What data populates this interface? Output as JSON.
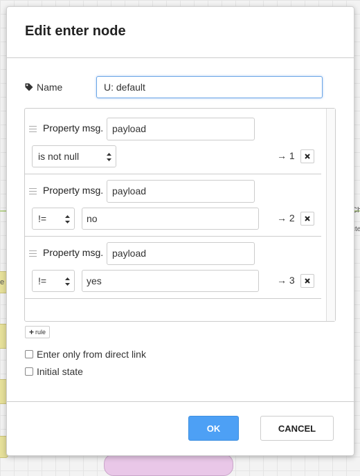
{
  "workspace": {
    "left_node_text": "te",
    "bottom_left_node_text": "t",
    "right_text_1": "Ch",
    "right_text_2": "cte"
  },
  "dialog": {
    "title": "Edit enter node",
    "name_label": "Name",
    "name_value": "U: default",
    "rules": [
      {
        "property_label": "Property msg.",
        "property_value": "payload",
        "operator": "is not null",
        "value": "",
        "output": "→ 1",
        "delete_icon": "x-icon"
      },
      {
        "property_label": "Property msg.",
        "property_value": "payload",
        "operator": "!=",
        "value": "no",
        "output": "→ 2",
        "delete_icon": "x-icon"
      },
      {
        "property_label": "Property msg.",
        "property_value": "payload",
        "operator": "!=",
        "value": "yes",
        "output": "→ 3",
        "delete_icon": "x-icon"
      }
    ],
    "add_rule_label": "rule",
    "checkbox_direct_link": "Enter only from direct link",
    "checkbox_initial_state": "Initial state",
    "ok_label": "OK",
    "cancel_label": "CANCEL"
  },
  "colors": {
    "primary_button": "#4da0f5",
    "focus_border": "#6aa6e6"
  }
}
